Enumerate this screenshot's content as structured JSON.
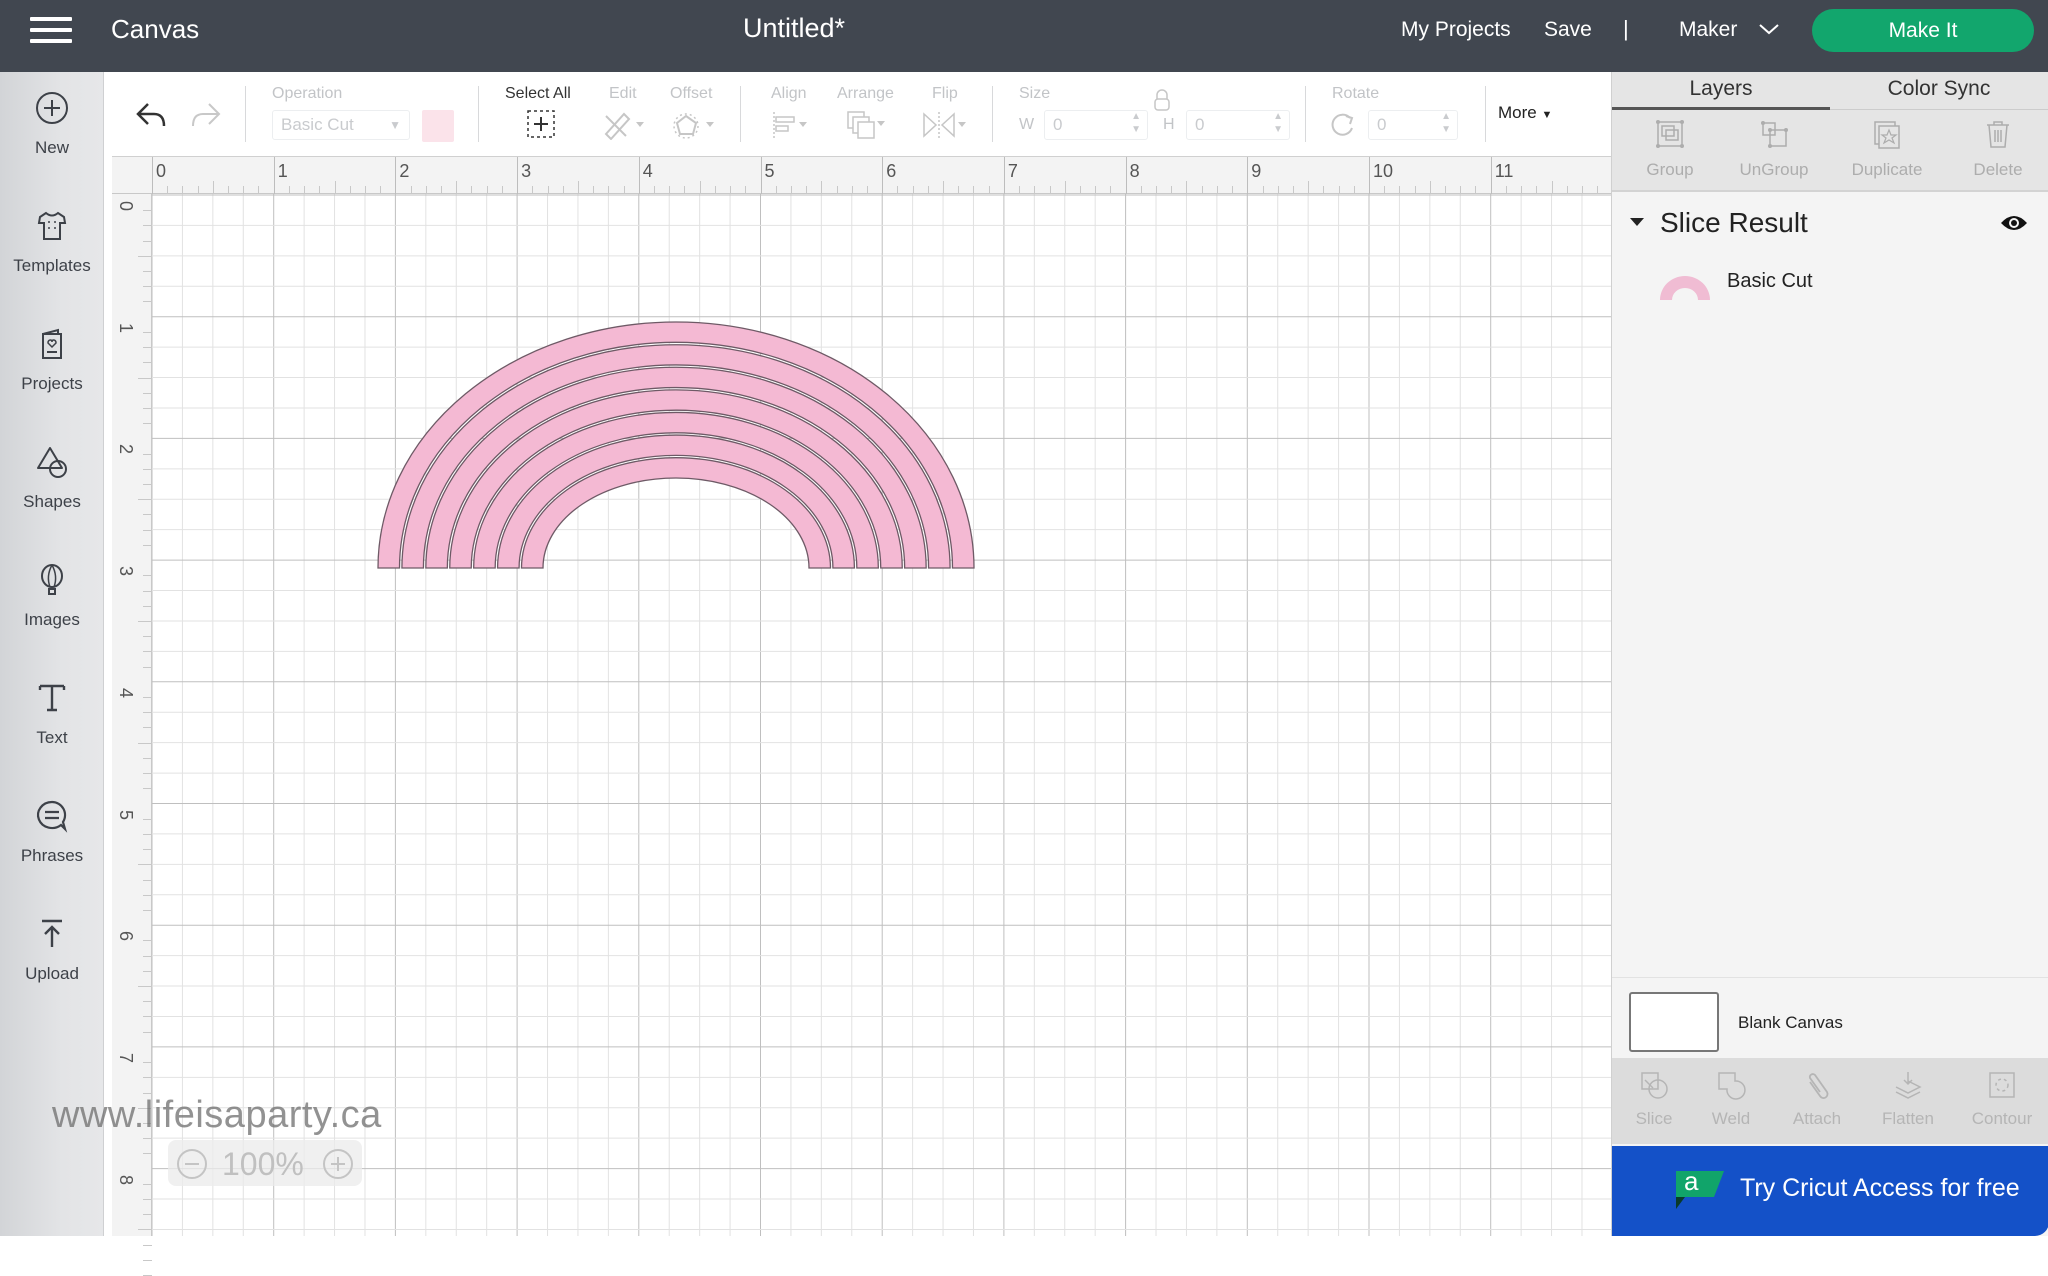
{
  "header": {
    "app_title": "Canvas",
    "document_title": "Untitled*",
    "my_projects": "My Projects",
    "save": "Save",
    "separator": "|",
    "machine": "Maker",
    "make_it": "Make It",
    "make_it_color": "#12a66d"
  },
  "leftnav": {
    "items": [
      {
        "label": "New",
        "icon": "plus-circle-icon"
      },
      {
        "label": "Templates",
        "icon": "tshirt-icon"
      },
      {
        "label": "Projects",
        "icon": "card-heart-icon"
      },
      {
        "label": "Shapes",
        "icon": "shapes-icon"
      },
      {
        "label": "Images",
        "icon": "balloon-icon"
      },
      {
        "label": "Text",
        "icon": "text-icon"
      },
      {
        "label": "Phrases",
        "icon": "speech-bubble-icon"
      },
      {
        "label": "Upload",
        "icon": "upload-icon"
      }
    ]
  },
  "toolbar": {
    "operation_label": "Operation",
    "operation_value": "Basic Cut",
    "operation_color": "#fbe3ea",
    "select_all": "Select All",
    "edit": "Edit",
    "offset": "Offset",
    "align": "Align",
    "arrange": "Arrange",
    "flip": "Flip",
    "size": "Size",
    "w_label": "W",
    "w_value": "0",
    "h_label": "H",
    "h_value": "0",
    "rotate": "Rotate",
    "rotate_value": "0",
    "more": "More"
  },
  "rulers": {
    "horizontal": [
      "0",
      "1",
      "2",
      "3",
      "4",
      "5",
      "6",
      "7",
      "8",
      "9",
      "10",
      "11"
    ],
    "vertical": [
      "0",
      "1",
      "2",
      "3",
      "4",
      "5",
      "6",
      "7",
      "8"
    ]
  },
  "canvas": {
    "shape": "rainbow",
    "band_count": 7,
    "fill_color": "#f4b9d3",
    "stroke_color": "#6e5a66",
    "watermark": "www.lifeisaparty.ca",
    "zoom": "100%"
  },
  "right_panel": {
    "tabs": [
      {
        "label": "Layers",
        "active": true
      },
      {
        "label": "Color Sync",
        "active": false
      }
    ],
    "layer_tools": [
      "Group",
      "UnGroup",
      "Duplicate",
      "Delete"
    ],
    "group_name": "Slice Result",
    "layers": [
      {
        "name": "Basic Cut",
        "color": "#f0bcd3"
      }
    ],
    "blank_canvas": "Blank Canvas",
    "bottom_tools": [
      "Slice",
      "Weld",
      "Attach",
      "Flatten",
      "Contour"
    ],
    "access_banner": "Try Cricut Access for free",
    "access_badge_letter": "a",
    "access_color": "#1451c8"
  }
}
